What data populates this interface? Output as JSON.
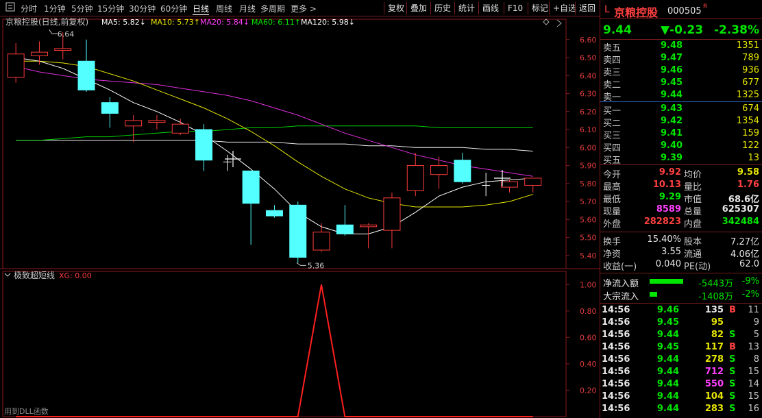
{
  "toolbar": {
    "periods": [
      "分时",
      "1分钟",
      "5分钟",
      "15分钟",
      "30分钟",
      "60分钟",
      "日线",
      "周线",
      "月线",
      "多周期",
      "更多 >"
    ],
    "active_period": "日线",
    "actions": [
      "复权",
      "叠加",
      "历史",
      "统计",
      "画线",
      "F10",
      "标记",
      "+自选",
      "返回"
    ]
  },
  "main_chart": {
    "stock_label": "京粮控股(日线,前复权)",
    "ma_legend": [
      {
        "label": "MA5: 5.82↓",
        "color": "#ffffff"
      },
      {
        "label": "MA10: 5.73↑",
        "color": "#e6e600"
      },
      {
        "label": "MA20: 5.84↓",
        "color": "#ff40ff"
      },
      {
        "label": "MA60: 6.11↑",
        "color": "#00e600"
      },
      {
        "label": "MA120: 5.98↓",
        "color": "#ffffff"
      }
    ],
    "high_marker": "6.64",
    "low_marker": "5.36",
    "y_ticks": [
      "6.60",
      "6.50",
      "6.40",
      "6.30",
      "6.20",
      "6.10",
      "6.00",
      "5.90",
      "5.80",
      "5.70",
      "5.60",
      "5.50",
      "5.40"
    ]
  },
  "sub_chart": {
    "indicator_name": "极致超短线",
    "indicator_value": "XG: 0.00",
    "y_ticks": [
      "1.00",
      "0.80",
      "0.60",
      "0.40",
      "0.20"
    ],
    "footer_text": "用到DLL函数"
  },
  "chart_data": {
    "type": "candlestick",
    "candles": [
      {
        "open": 6.39,
        "close": 6.52,
        "high": 6.58,
        "low": 6.36
      },
      {
        "open": 6.51,
        "close": 6.53,
        "high": 6.59,
        "low": 6.46
      },
      {
        "open": 6.54,
        "close": 6.55,
        "high": 6.64,
        "low": 6.49
      },
      {
        "open": 6.48,
        "close": 6.32,
        "high": 6.6,
        "low": 6.31
      },
      {
        "open": 6.25,
        "close": 6.19,
        "high": 6.28,
        "low": 6.11
      },
      {
        "open": 6.12,
        "close": 6.15,
        "high": 6.18,
        "low": 6.03
      },
      {
        "open": 6.14,
        "close": 6.15,
        "high": 6.18,
        "low": 6.1
      },
      {
        "open": 6.08,
        "close": 6.13,
        "high": 6.16,
        "low": 6.07
      },
      {
        "open": 6.1,
        "close": 5.93,
        "high": 6.13,
        "low": 5.87
      },
      {
        "open": 5.92,
        "close": 5.92,
        "high": 5.96,
        "low": 5.87
      },
      {
        "open": 5.87,
        "close": 5.69,
        "high": 5.87,
        "low": 5.46
      },
      {
        "open": 5.65,
        "close": 5.62,
        "high": 5.68,
        "low": 5.61
      },
      {
        "open": 5.68,
        "close": 5.39,
        "high": 5.7,
        "low": 5.36
      },
      {
        "open": 5.43,
        "close": 5.53,
        "high": 5.58,
        "low": 5.42
      },
      {
        "open": 5.57,
        "close": 5.52,
        "high": 5.68,
        "low": 5.51
      },
      {
        "open": 5.56,
        "close": 5.57,
        "high": 5.58,
        "low": 5.44
      },
      {
        "open": 5.54,
        "close": 5.72,
        "high": 5.75,
        "low": 5.44
      },
      {
        "open": 5.76,
        "close": 5.9,
        "high": 5.97,
        "low": 5.73
      },
      {
        "open": 5.85,
        "close": 5.9,
        "high": 5.95,
        "low": 5.77
      },
      {
        "open": 5.93,
        "close": 5.81,
        "high": 5.97,
        "low": 5.8
      },
      {
        "open": 5.79,
        "close": 5.79,
        "high": 5.86,
        "low": 5.73
      },
      {
        "open": 5.78,
        "close": 5.81,
        "high": 5.82,
        "low": 5.75
      },
      {
        "open": 5.79,
        "close": 5.83,
        "high": 5.83,
        "low": 5.75
      }
    ],
    "ma5": [
      6.5,
      6.48,
      6.44,
      6.38,
      6.32,
      6.25,
      6.2,
      6.14,
      6.07,
      5.98,
      5.88,
      5.77,
      5.64,
      5.56,
      5.52,
      5.52,
      5.56,
      5.64,
      5.73,
      5.78,
      5.81,
      5.82,
      5.83
    ],
    "ma10": [
      6.48,
      6.48,
      6.47,
      6.45,
      6.41,
      6.37,
      6.32,
      6.27,
      6.22,
      6.16,
      6.09,
      6.01,
      5.92,
      5.84,
      5.77,
      5.72,
      5.69,
      5.67,
      5.67,
      5.67,
      5.68,
      5.7,
      5.74
    ],
    "ma20": [
      6.45,
      6.42,
      6.4,
      6.38,
      6.37,
      6.36,
      6.35,
      6.33,
      6.31,
      6.29,
      6.26,
      6.22,
      6.18,
      6.13,
      6.08,
      6.04,
      6.0,
      5.96,
      5.93,
      5.9,
      5.88,
      5.86,
      5.84
    ],
    "ma60": [
      6.04,
      6.04,
      6.05,
      6.06,
      6.06,
      6.07,
      6.08,
      6.09,
      6.09,
      6.1,
      6.11,
      6.11,
      6.12,
      6.12,
      6.12,
      6.12,
      6.12,
      6.12,
      6.11,
      6.11,
      6.11,
      6.11,
      6.11
    ],
    "ma120": [
      6.04,
      6.04,
      6.04,
      6.04,
      6.04,
      6.04,
      6.04,
      6.04,
      6.04,
      6.03,
      6.03,
      6.03,
      6.02,
      6.02,
      6.02,
      6.01,
      6.01,
      6.0,
      6.0,
      6.0,
      5.99,
      5.99,
      5.98
    ],
    "xg": [
      0,
      0,
      0,
      0,
      0,
      0,
      0,
      0,
      0,
      0,
      0,
      0,
      0,
      1,
      0,
      0,
      0,
      0,
      0,
      0,
      0,
      0,
      0
    ],
    "ylim": [
      5.35,
      6.66
    ],
    "xg_ylim": [
      0,
      1.1
    ]
  },
  "quote": {
    "prefix": "L",
    "name": "京粮控股",
    "code": "000505",
    "badge": "R",
    "price": "9.44",
    "change": "▼-0.23",
    "change_pct": "-2.38%"
  },
  "order_book": {
    "asks": [
      {
        "label": "卖五",
        "price": "9.48",
        "vol": "1351"
      },
      {
        "label": "卖四",
        "price": "9.47",
        "vol": "789"
      },
      {
        "label": "卖三",
        "price": "9.46",
        "vol": "936"
      },
      {
        "label": "卖二",
        "price": "9.45",
        "vol": "677"
      },
      {
        "label": "卖一",
        "price": "9.44",
        "vol": "1325"
      }
    ],
    "bids": [
      {
        "label": "买一",
        "price": "9.43",
        "vol": "674"
      },
      {
        "label": "买二",
        "price": "9.42",
        "vol": "1354"
      },
      {
        "label": "买三",
        "price": "9.41",
        "vol": "159"
      },
      {
        "label": "买四",
        "price": "9.40",
        "vol": "122"
      },
      {
        "label": "买五",
        "price": "9.39",
        "vol": "13"
      }
    ]
  },
  "stats": [
    {
      "l1": "今开",
      "v1": "9.92",
      "c1": "red",
      "l2": "均价",
      "v2": "9.58",
      "c2": "yellow"
    },
    {
      "l1": "最高",
      "v1": "10.13",
      "c1": "red",
      "l2": "量比",
      "v2": "1.76",
      "c2": "red"
    },
    {
      "l1": "最低",
      "v1": "9.29",
      "c1": "green",
      "l2": "市值",
      "v2": "68.6亿",
      "c2": "white"
    },
    {
      "l1": "现量",
      "v1": "8589",
      "c1": "magenta",
      "l2": "总量",
      "v2": "625307",
      "c2": "white"
    },
    {
      "l1": "外盘",
      "v1": "282823",
      "c1": "red",
      "l2": "内盘",
      "v2": "342484",
      "c2": "green"
    }
  ],
  "stats2": [
    {
      "l1": "换手",
      "v1": "15.40%",
      "l2": "股本",
      "v2": "7.27亿"
    },
    {
      "l1": "净资",
      "v1": "3.55",
      "l2": "流通",
      "v2": "4.06亿"
    },
    {
      "l1": "收益(一)",
      "v1": "0.040",
      "l2": "PE(动)",
      "v2": "62.0"
    }
  ],
  "flows": [
    {
      "label": "净流入额",
      "value": "-5443万",
      "pct": "-9%",
      "bar": 0.9
    },
    {
      "label": "大宗流入",
      "value": "-1408万",
      "pct": "-2%",
      "bar": 0.2
    }
  ],
  "ticks": [
    {
      "time": "14:56",
      "price": "9.46",
      "vol": "135",
      "side": "B",
      "n": "11",
      "vc": "white"
    },
    {
      "time": "14:56",
      "price": "9.45",
      "vol": "95",
      "side": "",
      "n": "9",
      "vc": "yellow"
    },
    {
      "time": "14:56",
      "price": "9.44",
      "vol": "82",
      "side": "S",
      "n": "5",
      "vc": "yellow"
    },
    {
      "time": "14:56",
      "price": "9.45",
      "vol": "117",
      "side": "B",
      "n": "13",
      "vc": "yellow"
    },
    {
      "time": "14:56",
      "price": "9.44",
      "vol": "278",
      "side": "S",
      "n": "8",
      "vc": "yellow"
    },
    {
      "time": "14:56",
      "price": "9.44",
      "vol": "712",
      "side": "S",
      "n": "15",
      "vc": "magenta"
    },
    {
      "time": "14:56",
      "price": "9.44",
      "vol": "550",
      "side": "S",
      "n": "14",
      "vc": "magenta"
    },
    {
      "time": "14:56",
      "price": "9.44",
      "vol": "104",
      "side": "S",
      "n": "15",
      "vc": "yellow"
    },
    {
      "time": "14:56",
      "price": "9.44",
      "vol": "283",
      "side": "S",
      "n": "16",
      "vc": "yellow"
    }
  ]
}
